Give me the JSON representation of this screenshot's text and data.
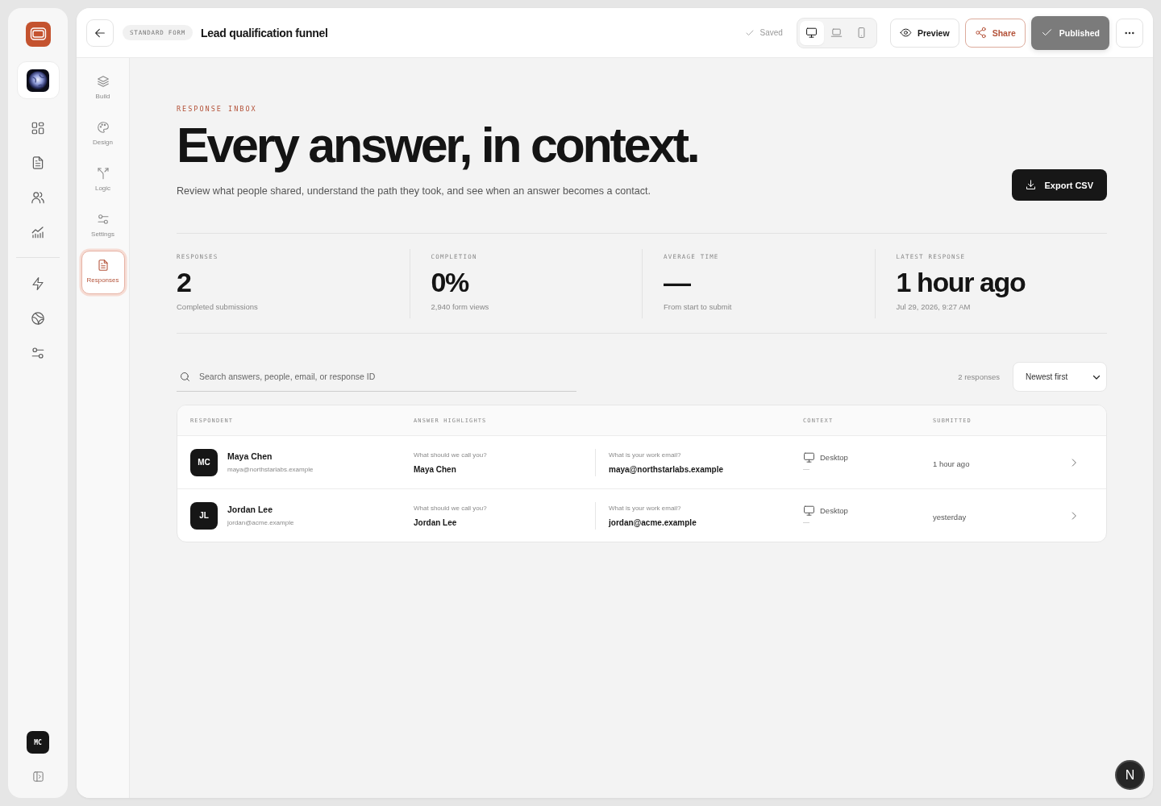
{
  "rail": {
    "user_initials": "MC"
  },
  "topbar": {
    "form_type": "STANDARD FORM",
    "title": "Lead qualification funnel",
    "save_status": "Saved",
    "device_modes": [
      {
        "kind": "desktop",
        "selected": true
      },
      {
        "kind": "laptop",
        "selected": false
      },
      {
        "kind": "mobile",
        "selected": false
      }
    ],
    "buttons": [
      {
        "kind": "preview",
        "label": "Preview"
      },
      {
        "kind": "share",
        "label": "Share"
      },
      {
        "kind": "publish",
        "label": "Published"
      }
    ]
  },
  "builder_nav": [
    {
      "kind": "build",
      "label": "Build",
      "selected": false
    },
    {
      "kind": "design",
      "label": "Design",
      "selected": false
    },
    {
      "kind": "logic",
      "label": "Logic",
      "selected": false
    },
    {
      "kind": "settings",
      "label": "Settings",
      "selected": false
    },
    {
      "kind": "responses",
      "label": "Responses",
      "selected": true
    }
  ],
  "hero": {
    "eyebrow": "RESPONSE INBOX",
    "title": "Every answer, in context.",
    "subtitle": "Review what people shared, understand the path they took, and see when an answer becomes a contact.",
    "export_button": "Export CSV"
  },
  "stats": [
    {
      "label": "RESPONSES",
      "value": "2",
      "note": "Completed submissions"
    },
    {
      "label": "COMPLETION",
      "value": "0%",
      "note": "2,940 form views"
    },
    {
      "label": "AVERAGE TIME",
      "value": "—",
      "note": "From start to submit"
    },
    {
      "label": "LATEST RESPONSE",
      "value": "1 hour ago",
      "note": "Jul 29, 2026, 9:27 AM"
    }
  ],
  "toolbar": {
    "search": {
      "placeholder": "Search answers, people, email, or response ID"
    },
    "count": "2 responses",
    "sort": "Newest first"
  },
  "table": {
    "columns": [
      "RESPONDENT",
      "ANSWER HIGHLIGHTS",
      "CONTEXT",
      "SUBMITTED"
    ],
    "rows": [
      {
        "initials": "MC",
        "name": "Maya Chen",
        "email": "maya@northstarlabs.example",
        "answers": [
          {
            "question": "What should we call you?",
            "answer": "Maya Chen"
          },
          {
            "question": "What is your work email?",
            "answer": "maya@northstarlabs.example"
          }
        ],
        "device": "Desktop",
        "device_detail": "—",
        "submitted": "1 hour ago"
      },
      {
        "initials": "JL",
        "name": "Jordan Lee",
        "email": "jordan@acme.example",
        "answers": [
          {
            "question": "What should we call you?",
            "answer": "Jordan Lee"
          },
          {
            "question": "What is your work email?",
            "answer": "jordan@acme.example"
          }
        ],
        "device": "Desktop",
        "device_detail": "—",
        "submitted": "yesterday"
      }
    ]
  },
  "dev_badge": "N"
}
